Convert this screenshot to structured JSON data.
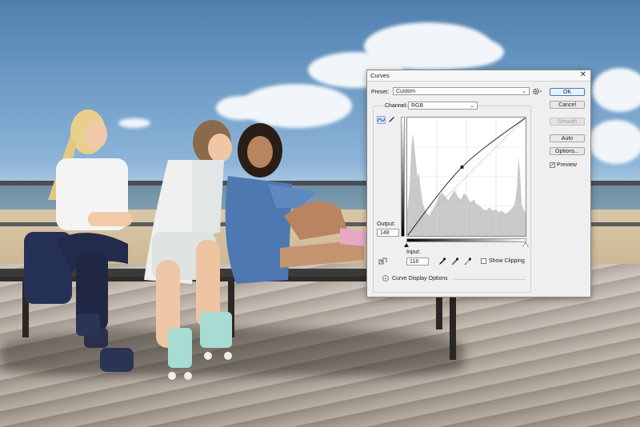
{
  "dialog": {
    "title": "Curves",
    "close_glyph": "✕",
    "preset_label": "Preset:",
    "preset_value": "Custom",
    "preset_options_icon": "gear-icon",
    "channel_label": "Channel:",
    "channel_value": "RGB",
    "output_label": "Output:",
    "output_value": "148",
    "input_label": "Input:",
    "input_value": "118",
    "show_clipping_label": "Show Clipping",
    "show_clipping_checked": false,
    "curve_display_options_label": "Curve Display Options",
    "buttons": {
      "ok": "OK",
      "cancel": "Cancel",
      "smooth": "Smooth",
      "auto": "Auto",
      "options": "Options..."
    },
    "preview_label": "Preview",
    "preview_checked": true,
    "curve": {
      "input_range": [
        0,
        255
      ],
      "points": [
        [
          0,
          0
        ],
        [
          118,
          148
        ],
        [
          255,
          255
        ]
      ]
    },
    "colors": {
      "accent": "#3d7bd0",
      "dialog_bg": "#efefef"
    }
  }
}
